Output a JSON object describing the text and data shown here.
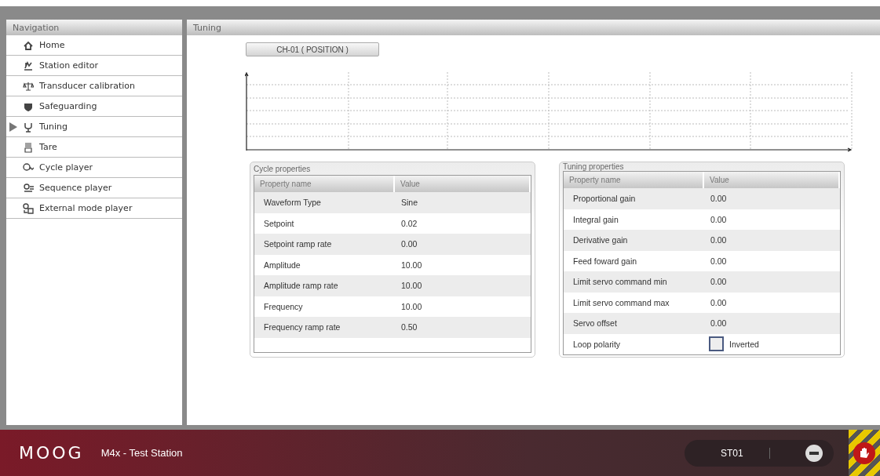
{
  "navigation": {
    "title": "Navigation",
    "items": [
      {
        "label": "Home",
        "selected": false
      },
      {
        "label": "Station editor",
        "selected": false
      },
      {
        "label": "Transducer calibration",
        "selected": false
      },
      {
        "label": "Safeguarding",
        "selected": false
      },
      {
        "label": "Tuning",
        "selected": true
      },
      {
        "label": "Tare",
        "selected": false
      },
      {
        "label": "Cycle player",
        "selected": false
      },
      {
        "label": "Sequence player",
        "selected": false
      },
      {
        "label": "External mode player",
        "selected": false
      }
    ]
  },
  "main": {
    "title": "Tuning",
    "channel_button": "CH-01 ( POSITION )",
    "cycle_properties": {
      "title": "Cycle properties",
      "columns": [
        "Property name",
        "Value"
      ],
      "rows": [
        {
          "name": "Waveform Type",
          "value": "Sine",
          "kind": "text"
        },
        {
          "name": "Setpoint",
          "value": "0.02",
          "kind": "text"
        },
        {
          "name": "Setpoint ramp rate",
          "value": "0.00",
          "kind": "text"
        },
        {
          "name": "Amplitude",
          "value": "10.00",
          "kind": "text"
        },
        {
          "name": "Amplitude ramp rate",
          "value": "10.00",
          "kind": "text"
        },
        {
          "name": "Frequency",
          "value": "10.00",
          "kind": "text"
        },
        {
          "name": "Frequency ramp rate",
          "value": "0.50",
          "kind": "text"
        }
      ]
    },
    "tuning_properties": {
      "title": "Tuning properties",
      "columns": [
        "Property name",
        "Value"
      ],
      "rows": [
        {
          "name": "Proportional gain",
          "value": "0.00",
          "kind": "text"
        },
        {
          "name": "Integral gain",
          "value": "0.00",
          "kind": "text"
        },
        {
          "name": "Derivative gain",
          "value": "0.00",
          "kind": "text"
        },
        {
          "name": "Feed foward gain",
          "value": "0.00",
          "kind": "text"
        },
        {
          "name": "Limit servo command min",
          "value": "0.00",
          "kind": "text"
        },
        {
          "name": "Limit servo command max",
          "value": "0.00",
          "kind": "text"
        },
        {
          "name": "Servo offset",
          "value": "0.00",
          "kind": "text"
        },
        {
          "name": "Loop polarity",
          "value": "Inverted",
          "kind": "checkbox",
          "checked": false
        }
      ]
    }
  },
  "footer": {
    "logo": "MOOG",
    "station_name": "M4x - Test Station",
    "station_id": "ST01"
  }
}
